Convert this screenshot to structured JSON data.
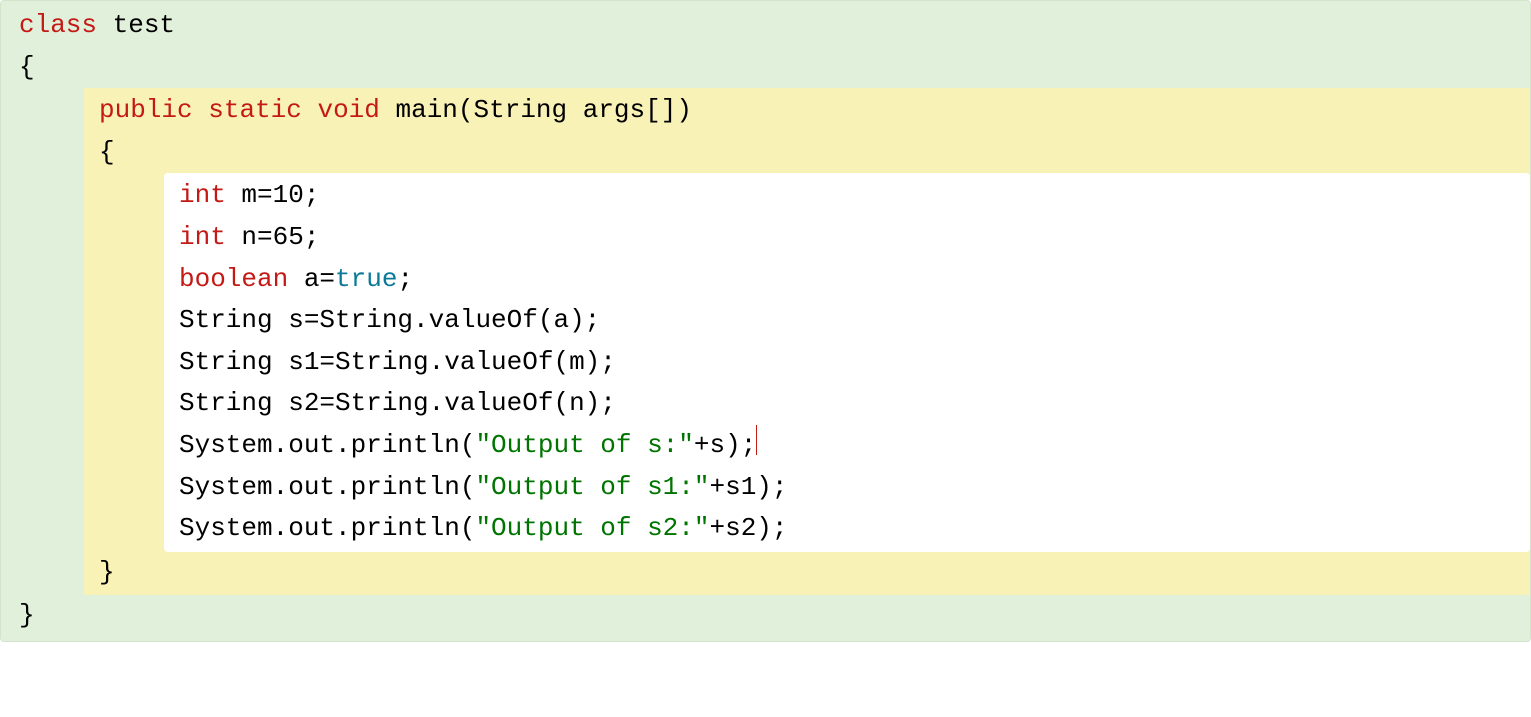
{
  "outer": {
    "line1_kw": "class",
    "line1_rest": " test",
    "line2": "{",
    "line_close": "}"
  },
  "middle": {
    "line1_kw1": "public",
    "line1_sp1": " ",
    "line1_kw2": "static",
    "line1_sp2": " ",
    "line1_kw3": "void",
    "line1_rest": " main(String args[])",
    "line2": "{",
    "line_close": "}"
  },
  "inner": {
    "l1_kw": "int",
    "l1_rest": " m=10;",
    "l2_kw": "int",
    "l2_rest": " n=65;",
    "l3_kw": "boolean",
    "l3_mid": " a=",
    "l3_val": "true",
    "l3_end": ";",
    "l4": "String s=String.valueOf(a);",
    "l5": "String s1=String.valueOf(m);",
    "l6": "String s2=String.valueOf(n);",
    "l7": "",
    "l8_pre": "System.out.println(",
    "l8_str": "\"Output of s:\"",
    "l8_post": "+s);",
    "l9_pre": "System.out.println(",
    "l9_str": "\"Output of s1:\"",
    "l9_post": "+s1);",
    "l10_pre": "System.out.println(",
    "l10_str": "\"Output of s2:\"",
    "l10_post": "+s2);"
  }
}
